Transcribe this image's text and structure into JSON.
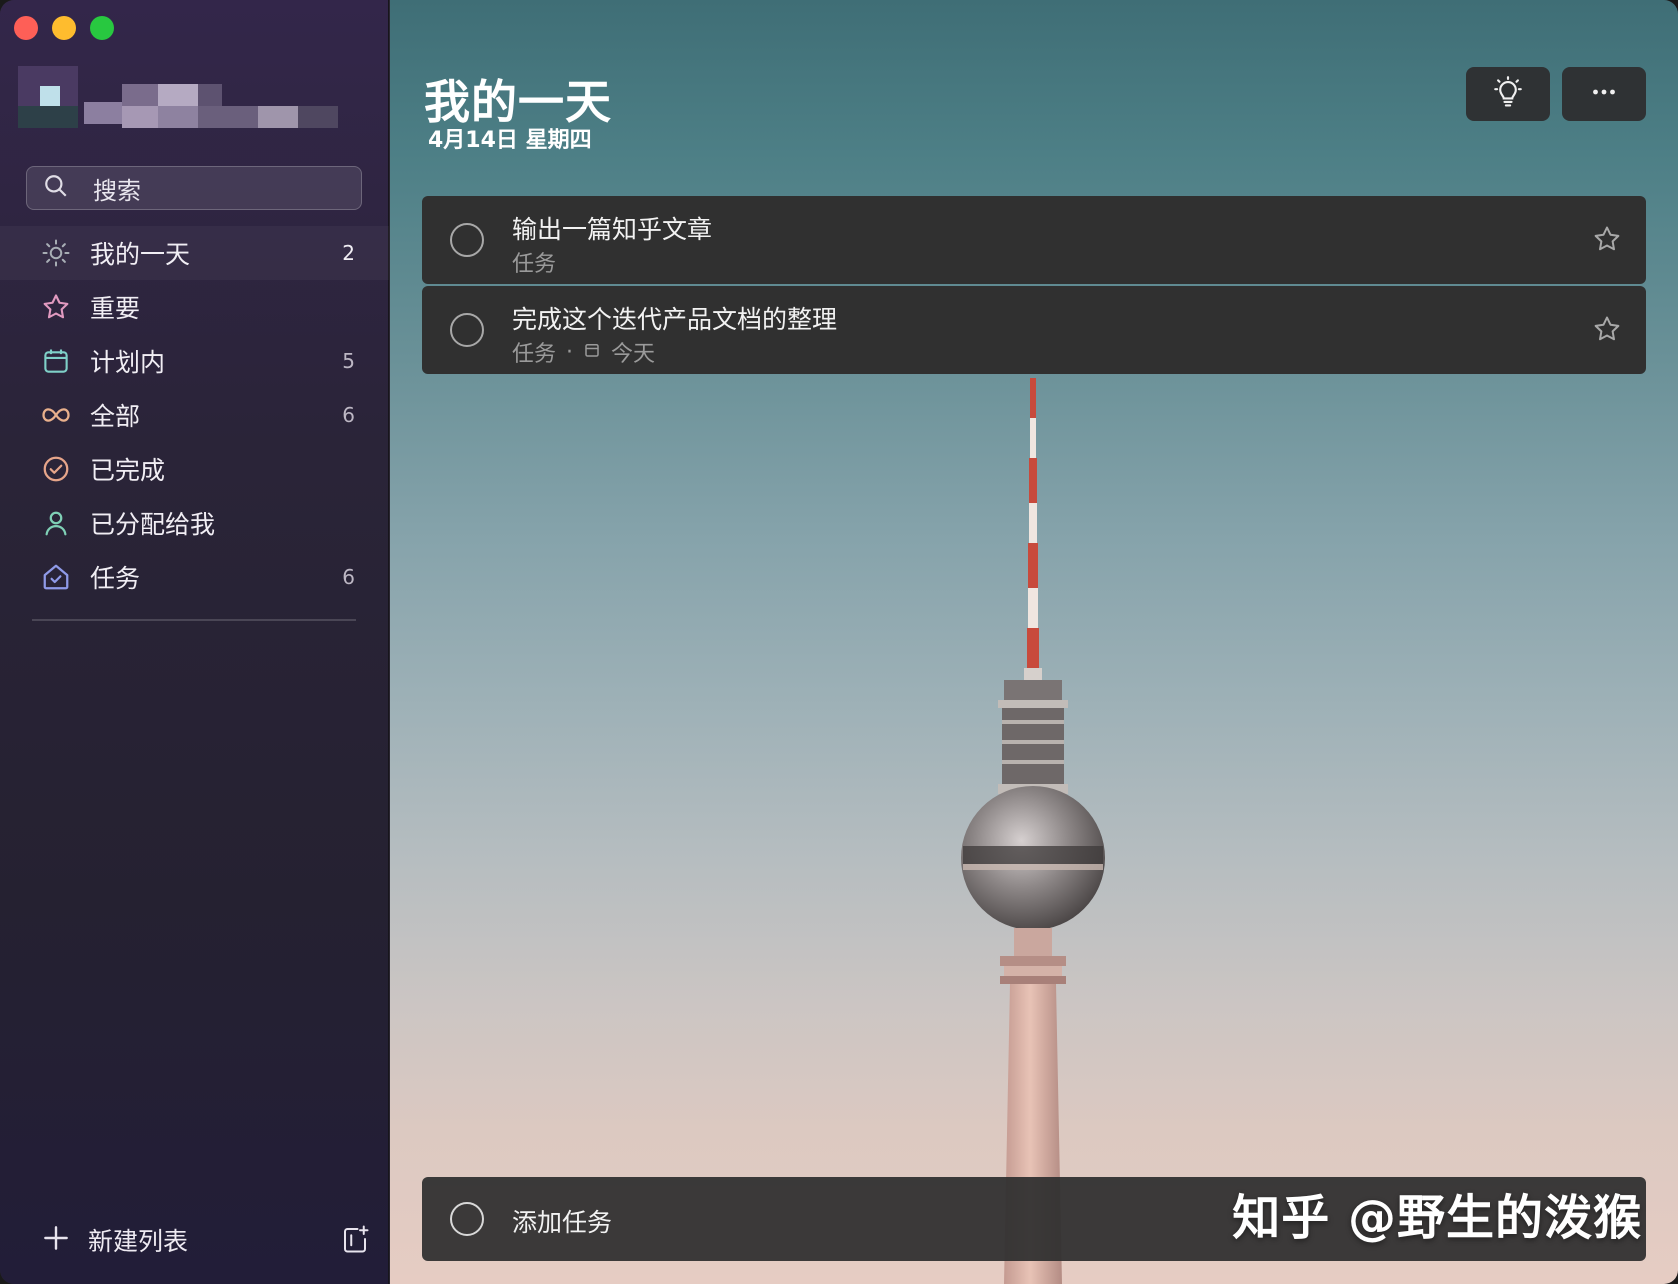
{
  "window": {
    "controls": [
      "close",
      "minimize",
      "zoom"
    ]
  },
  "sidebar": {
    "search": {
      "label": "搜索",
      "icon": "search-icon"
    },
    "items": [
      {
        "id": "my-day",
        "label": "我的一天",
        "count": "2",
        "icon": "sun-icon",
        "color": "#9aa1a8"
      },
      {
        "id": "important",
        "label": "重要",
        "count": "",
        "icon": "star-icon",
        "color": "#e19ac0"
      },
      {
        "id": "planned",
        "label": "计划内",
        "count": "5",
        "icon": "calendar-icon",
        "color": "#7fd0c8"
      },
      {
        "id": "all",
        "label": "全部",
        "count": "6",
        "icon": "infinity-icon",
        "color": "#e9b08c"
      },
      {
        "id": "completed",
        "label": "已完成",
        "count": "",
        "icon": "check-circle-icon",
        "color": "#e6a58a"
      },
      {
        "id": "assigned",
        "label": "已分配给我",
        "count": "",
        "icon": "person-icon",
        "color": "#7fd0b6"
      },
      {
        "id": "tasks",
        "label": "任务",
        "count": "6",
        "icon": "home-icon",
        "color": "#8f9ae8"
      }
    ],
    "new_list": {
      "label": "新建列表",
      "icon": "plus-icon",
      "group_icon": "new-group-icon"
    }
  },
  "main": {
    "title": "我的一天",
    "subtitle": "4月14日 星期四",
    "toolbar": {
      "suggestions_icon": "lightbulb-icon",
      "more_icon": "more-icon"
    },
    "tasks": [
      {
        "title": "输出一篇知乎文章",
        "list": "任务",
        "due": "",
        "starred": false
      },
      {
        "title": "完成这个迭代产品文档的整理",
        "list": "任务",
        "separator": "·",
        "due": "今天",
        "starred": false
      }
    ],
    "add_task": {
      "label": "添加任务"
    },
    "watermark": "知乎 @野生的泼猴"
  }
}
